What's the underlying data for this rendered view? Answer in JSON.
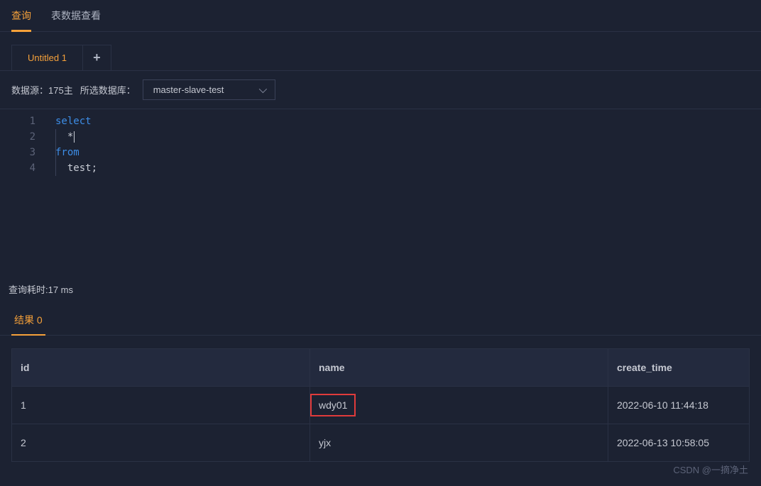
{
  "topTabs": {
    "active": "查询",
    "other": "表数据查看"
  },
  "fileTabs": {
    "tab0": "Untitled 1"
  },
  "toolbar": {
    "datasourceLabel": "数据源：175主",
    "dbLabel": "所选数据库：",
    "dbSelected": "master-slave-test"
  },
  "editor": {
    "lines": {
      "l1n": "1",
      "l2n": "2",
      "l3n": "3",
      "l4n": "4",
      "l1": "select",
      "l2": "*",
      "l3": "from",
      "l4": "test;"
    }
  },
  "status": {
    "queryTime": "查询耗时:17 ms"
  },
  "results": {
    "tabLabel": "结果 0",
    "headers": {
      "id": "id",
      "name": "name",
      "create_time": "create_time"
    },
    "rows": [
      {
        "id": "1",
        "name": "wdy01",
        "create_time": "2022-06-10 11:44:18"
      },
      {
        "id": "2",
        "name": "yjx",
        "create_time": "2022-06-13 10:58:05"
      }
    ]
  },
  "watermark": "CSDN @一摘净土"
}
